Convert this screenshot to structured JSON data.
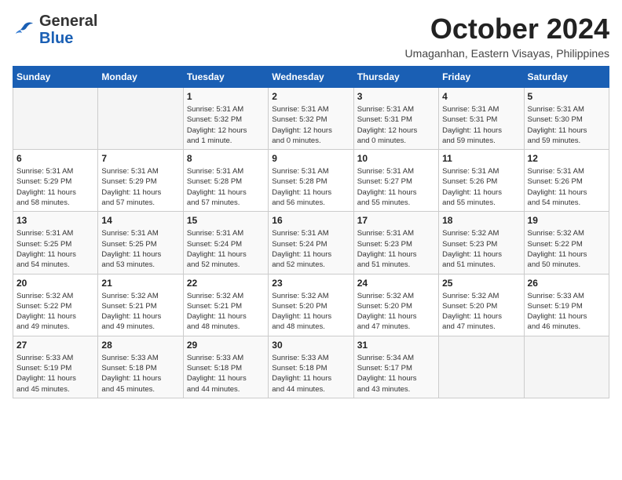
{
  "header": {
    "logo_line1": "General",
    "logo_line2": "Blue",
    "month": "October 2024",
    "location": "Umaganhan, Eastern Visayas, Philippines"
  },
  "days_of_week": [
    "Sunday",
    "Monday",
    "Tuesday",
    "Wednesday",
    "Thursday",
    "Friday",
    "Saturday"
  ],
  "weeks": [
    [
      {
        "day": "",
        "info": ""
      },
      {
        "day": "",
        "info": ""
      },
      {
        "day": "1",
        "info": "Sunrise: 5:31 AM\nSunset: 5:32 PM\nDaylight: 12 hours\nand 1 minute."
      },
      {
        "day": "2",
        "info": "Sunrise: 5:31 AM\nSunset: 5:32 PM\nDaylight: 12 hours\nand 0 minutes."
      },
      {
        "day": "3",
        "info": "Sunrise: 5:31 AM\nSunset: 5:31 PM\nDaylight: 12 hours\nand 0 minutes."
      },
      {
        "day": "4",
        "info": "Sunrise: 5:31 AM\nSunset: 5:31 PM\nDaylight: 11 hours\nand 59 minutes."
      },
      {
        "day": "5",
        "info": "Sunrise: 5:31 AM\nSunset: 5:30 PM\nDaylight: 11 hours\nand 59 minutes."
      }
    ],
    [
      {
        "day": "6",
        "info": "Sunrise: 5:31 AM\nSunset: 5:29 PM\nDaylight: 11 hours\nand 58 minutes."
      },
      {
        "day": "7",
        "info": "Sunrise: 5:31 AM\nSunset: 5:29 PM\nDaylight: 11 hours\nand 57 minutes."
      },
      {
        "day": "8",
        "info": "Sunrise: 5:31 AM\nSunset: 5:28 PM\nDaylight: 11 hours\nand 57 minutes."
      },
      {
        "day": "9",
        "info": "Sunrise: 5:31 AM\nSunset: 5:28 PM\nDaylight: 11 hours\nand 56 minutes."
      },
      {
        "day": "10",
        "info": "Sunrise: 5:31 AM\nSunset: 5:27 PM\nDaylight: 11 hours\nand 55 minutes."
      },
      {
        "day": "11",
        "info": "Sunrise: 5:31 AM\nSunset: 5:26 PM\nDaylight: 11 hours\nand 55 minutes."
      },
      {
        "day": "12",
        "info": "Sunrise: 5:31 AM\nSunset: 5:26 PM\nDaylight: 11 hours\nand 54 minutes."
      }
    ],
    [
      {
        "day": "13",
        "info": "Sunrise: 5:31 AM\nSunset: 5:25 PM\nDaylight: 11 hours\nand 54 minutes."
      },
      {
        "day": "14",
        "info": "Sunrise: 5:31 AM\nSunset: 5:25 PM\nDaylight: 11 hours\nand 53 minutes."
      },
      {
        "day": "15",
        "info": "Sunrise: 5:31 AM\nSunset: 5:24 PM\nDaylight: 11 hours\nand 52 minutes."
      },
      {
        "day": "16",
        "info": "Sunrise: 5:31 AM\nSunset: 5:24 PM\nDaylight: 11 hours\nand 52 minutes."
      },
      {
        "day": "17",
        "info": "Sunrise: 5:31 AM\nSunset: 5:23 PM\nDaylight: 11 hours\nand 51 minutes."
      },
      {
        "day": "18",
        "info": "Sunrise: 5:32 AM\nSunset: 5:23 PM\nDaylight: 11 hours\nand 51 minutes."
      },
      {
        "day": "19",
        "info": "Sunrise: 5:32 AM\nSunset: 5:22 PM\nDaylight: 11 hours\nand 50 minutes."
      }
    ],
    [
      {
        "day": "20",
        "info": "Sunrise: 5:32 AM\nSunset: 5:22 PM\nDaylight: 11 hours\nand 49 minutes."
      },
      {
        "day": "21",
        "info": "Sunrise: 5:32 AM\nSunset: 5:21 PM\nDaylight: 11 hours\nand 49 minutes."
      },
      {
        "day": "22",
        "info": "Sunrise: 5:32 AM\nSunset: 5:21 PM\nDaylight: 11 hours\nand 48 minutes."
      },
      {
        "day": "23",
        "info": "Sunrise: 5:32 AM\nSunset: 5:20 PM\nDaylight: 11 hours\nand 48 minutes."
      },
      {
        "day": "24",
        "info": "Sunrise: 5:32 AM\nSunset: 5:20 PM\nDaylight: 11 hours\nand 47 minutes."
      },
      {
        "day": "25",
        "info": "Sunrise: 5:32 AM\nSunset: 5:20 PM\nDaylight: 11 hours\nand 47 minutes."
      },
      {
        "day": "26",
        "info": "Sunrise: 5:33 AM\nSunset: 5:19 PM\nDaylight: 11 hours\nand 46 minutes."
      }
    ],
    [
      {
        "day": "27",
        "info": "Sunrise: 5:33 AM\nSunset: 5:19 PM\nDaylight: 11 hours\nand 45 minutes."
      },
      {
        "day": "28",
        "info": "Sunrise: 5:33 AM\nSunset: 5:18 PM\nDaylight: 11 hours\nand 45 minutes."
      },
      {
        "day": "29",
        "info": "Sunrise: 5:33 AM\nSunset: 5:18 PM\nDaylight: 11 hours\nand 44 minutes."
      },
      {
        "day": "30",
        "info": "Sunrise: 5:33 AM\nSunset: 5:18 PM\nDaylight: 11 hours\nand 44 minutes."
      },
      {
        "day": "31",
        "info": "Sunrise: 5:34 AM\nSunset: 5:17 PM\nDaylight: 11 hours\nand 43 minutes."
      },
      {
        "day": "",
        "info": ""
      },
      {
        "day": "",
        "info": ""
      }
    ]
  ]
}
